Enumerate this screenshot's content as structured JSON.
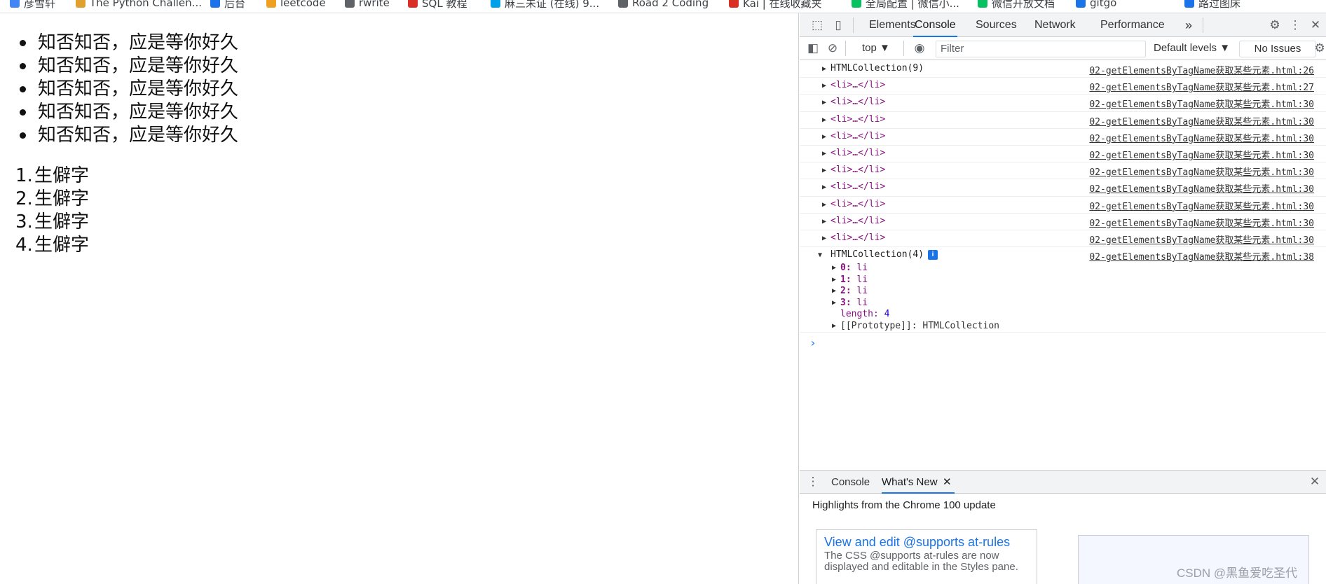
{
  "bookmarks": [
    {
      "label": "彦雪轩",
      "color": "#4285f4"
    },
    {
      "label": "The Python Challen...",
      "color": "#e0a030"
    },
    {
      "label": "后台",
      "color": "#1a73e8"
    },
    {
      "label": "leetcode",
      "color": "#f0a020"
    },
    {
      "label": "rwrite",
      "color": "#5f6368"
    },
    {
      "label": "SQL 教程",
      "color": "#d93025"
    },
    {
      "label": "麻三未证 (在线) 9...",
      "color": "#00a0e9"
    },
    {
      "label": "Road 2 Coding",
      "color": "#5f6368"
    },
    {
      "label": "Kai | 在线收藏夹",
      "color": "#d93025"
    },
    {
      "label": "全局配置 | 微信小...",
      "color": "#07c160"
    },
    {
      "label": "微信开放文档",
      "color": "#07c160"
    },
    {
      "label": "gitgo",
      "color": "#1a73e8"
    },
    {
      "label": "路过图床",
      "color": "#1a73e8"
    }
  ],
  "page": {
    "ul_items": [
      "知否知否，应是等你好久",
      "知否知否，应是等你好久",
      "知否知否，应是等你好久",
      "知否知否，应是等你好久",
      "知否知否，应是等你好久"
    ],
    "ol_items": [
      {
        "num": "1.",
        "text": "生僻字"
      },
      {
        "num": "2.",
        "text": "生僻字"
      },
      {
        "num": "3.",
        "text": "生僻字"
      },
      {
        "num": "4.",
        "text": "生僻字"
      }
    ]
  },
  "devtools": {
    "tabs": [
      "Elements",
      "Console",
      "Sources",
      "Network",
      "Performance"
    ],
    "more_tabs": "»",
    "active_tab": "Console",
    "toolbar": {
      "context": "top ▼",
      "filter_placeholder": "Filter",
      "levels": "Default levels ▼",
      "issues": "No Issues"
    },
    "console_rows": [
      {
        "msg": "HTMLCollection(9)",
        "tag": false,
        "src": "02-getElementsByTagName获取某些元素.html:26"
      },
      {
        "msg": "<li>…</li>",
        "tag": true,
        "src": "02-getElementsByTagName获取某些元素.html:27"
      },
      {
        "msg": "<li>…</li>",
        "tag": true,
        "src": "02-getElementsByTagName获取某些元素.html:30"
      },
      {
        "msg": "<li>…</li>",
        "tag": true,
        "src": "02-getElementsByTagName获取某些元素.html:30"
      },
      {
        "msg": "<li>…</li>",
        "tag": true,
        "src": "02-getElementsByTagName获取某些元素.html:30"
      },
      {
        "msg": "<li>…</li>",
        "tag": true,
        "src": "02-getElementsByTagName获取某些元素.html:30"
      },
      {
        "msg": "<li>…</li>",
        "tag": true,
        "src": "02-getElementsByTagName获取某些元素.html:30"
      },
      {
        "msg": "<li>…</li>",
        "tag": true,
        "src": "02-getElementsByTagName获取某些元素.html:30"
      },
      {
        "msg": "<li>…</li>",
        "tag": true,
        "src": "02-getElementsByTagName获取某些元素.html:30"
      },
      {
        "msg": "<li>…</li>",
        "tag": true,
        "src": "02-getElementsByTagName获取某些元素.html:30"
      },
      {
        "msg": "<li>…</li>",
        "tag": true,
        "src": "02-getElementsByTagName获取某些元素.html:30"
      }
    ],
    "expanded": {
      "msg": "HTMLCollection(4)",
      "info": "i",
      "src": "02-getElementsByTagName获取某些元素.html:38",
      "items": [
        {
          "key": "0:",
          "val": "li"
        },
        {
          "key": "1:",
          "val": "li"
        },
        {
          "key": "2:",
          "val": "li"
        },
        {
          "key": "3:",
          "val": "li"
        }
      ],
      "length_key": "length:",
      "length_val": "4",
      "prototype": "[[Prototype]]: HTMLCollection"
    },
    "prompt": "›",
    "drawer": {
      "tabs": [
        "Console",
        "What's New"
      ],
      "active": "What's New",
      "close": "✕",
      "highlights": "Highlights from the Chrome 100 update",
      "card_title": "View and edit @supports at-rules",
      "card_body": "The CSS @supports at-rules are now displayed and editable in the Styles pane."
    }
  },
  "watermark": "CSDN @黑鱼爱吃圣代"
}
